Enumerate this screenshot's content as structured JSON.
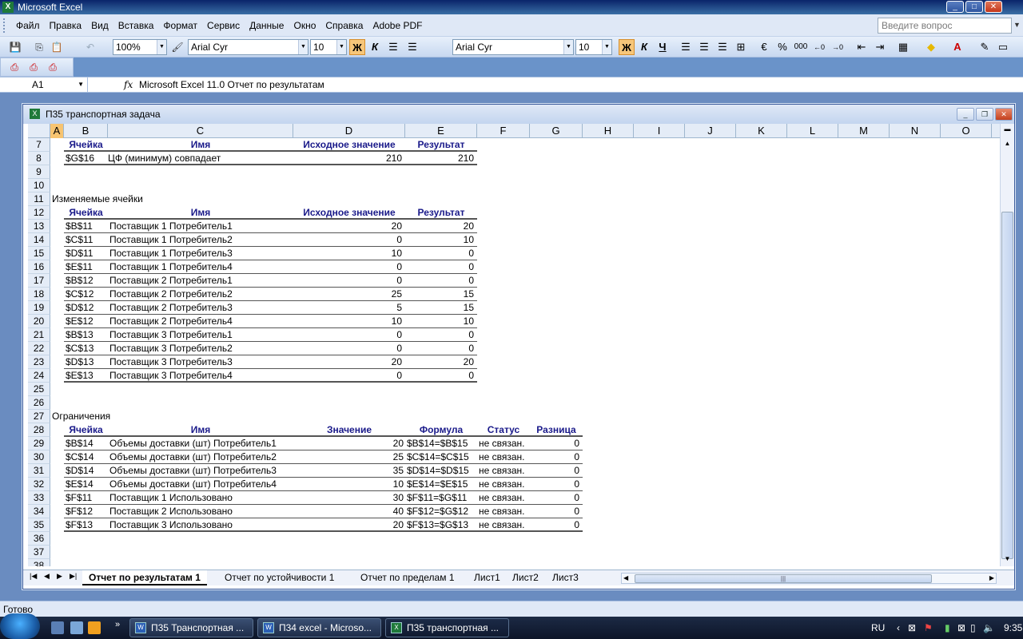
{
  "app": {
    "title": "Microsoft Excel",
    "ask_placeholder": "Введите вопрос"
  },
  "menu": [
    "Файл",
    "Правка",
    "Вид",
    "Вставка",
    "Формат",
    "Сервис",
    "Данные",
    "Окно",
    "Справка",
    "Adobe PDF"
  ],
  "toolbar": {
    "zoom": "100%",
    "font1": "Arial Cyr",
    "size1": "10",
    "font2": "Arial Cyr",
    "size2": "10",
    "bold": "Ж",
    "italic": "К",
    "underline": "Ч",
    "percent": "%",
    "thousands": "000"
  },
  "formula_bar": {
    "cell": "A1",
    "fx": "fx",
    "content": "Microsoft Excel 11.0 Отчет по результатам"
  },
  "workbook": {
    "title": "П35 транспортная задача"
  },
  "columns": [
    "A",
    "B",
    "C",
    "D",
    "E",
    "F",
    "G",
    "H",
    "I",
    "J",
    "K",
    "L",
    "M",
    "N",
    "O"
  ],
  "rows": [
    "7",
    "8",
    "9",
    "10",
    "11",
    "12",
    "13",
    "14",
    "15",
    "16",
    "17",
    "18",
    "19",
    "20",
    "21",
    "22",
    "23",
    "24",
    "25",
    "26",
    "27",
    "28",
    "29",
    "30",
    "31",
    "32",
    "33",
    "34",
    "35",
    "36",
    "37",
    "38"
  ],
  "target": {
    "headers": [
      "Ячейка",
      "Имя",
      "Исходное значение",
      "Результат"
    ],
    "row": {
      "cell": "$G$16",
      "name": "ЦФ (минимум) совпадает",
      "initial": "210",
      "result": "210"
    }
  },
  "variables": {
    "title": "Изменяемые ячейки",
    "headers": [
      "Ячейка",
      "Имя",
      "Исходное значение",
      "Результат"
    ],
    "rows": [
      {
        "cell": "$B$11",
        "name": "Поставщик 1 Потребитель1",
        "initial": "20",
        "result": "20"
      },
      {
        "cell": "$C$11",
        "name": "Поставщик 1 Потребитель2",
        "initial": "0",
        "result": "10"
      },
      {
        "cell": "$D$11",
        "name": "Поставщик 1 Потребитель3",
        "initial": "10",
        "result": "0"
      },
      {
        "cell": "$E$11",
        "name": "Поставщик 1 Потребитель4",
        "initial": "0",
        "result": "0"
      },
      {
        "cell": "$B$12",
        "name": "Поставщик 2 Потребитель1",
        "initial": "0",
        "result": "0"
      },
      {
        "cell": "$C$12",
        "name": "Поставщик 2 Потребитель2",
        "initial": "25",
        "result": "15"
      },
      {
        "cell": "$D$12",
        "name": "Поставщик 2 Потребитель3",
        "initial": "5",
        "result": "15"
      },
      {
        "cell": "$E$12",
        "name": "Поставщик 2 Потребитель4",
        "initial": "10",
        "result": "10"
      },
      {
        "cell": "$B$13",
        "name": "Поставщик 3 Потребитель1",
        "initial": "0",
        "result": "0"
      },
      {
        "cell": "$C$13",
        "name": "Поставщик 3 Потребитель2",
        "initial": "0",
        "result": "0"
      },
      {
        "cell": "$D$13",
        "name": "Поставщик 3 Потребитель3",
        "initial": "20",
        "result": "20"
      },
      {
        "cell": "$E$13",
        "name": "Поставщик 3 Потребитель4",
        "initial": "0",
        "result": "0"
      }
    ]
  },
  "constraints": {
    "title": "Ограничения",
    "headers": [
      "Ячейка",
      "Имя",
      "Значение",
      "Формула",
      "Статус",
      "Разница"
    ],
    "rows": [
      {
        "cell": "$B$14",
        "name": "Объемы доставки (шт) Потребитель1",
        "value": "20",
        "formula": "$B$14=$B$15",
        "status": "не связан.",
        "diff": "0"
      },
      {
        "cell": "$C$14",
        "name": "Объемы доставки (шт) Потребитель2",
        "value": "25",
        "formula": "$C$14=$C$15",
        "status": "не связан.",
        "diff": "0"
      },
      {
        "cell": "$D$14",
        "name": "Объемы доставки (шт) Потребитель3",
        "value": "35",
        "formula": "$D$14=$D$15",
        "status": "не связан.",
        "diff": "0"
      },
      {
        "cell": "$E$14",
        "name": "Объемы доставки (шт) Потребитель4",
        "value": "10",
        "formula": "$E$14=$E$15",
        "status": "не связан.",
        "diff": "0"
      },
      {
        "cell": "$F$11",
        "name": "Поставщик 1 Использовано",
        "value": "30",
        "formula": "$F$11=$G$11",
        "status": "не связан.",
        "diff": "0"
      },
      {
        "cell": "$F$12",
        "name": "Поставщик 2 Использовано",
        "value": "40",
        "formula": "$F$12=$G$12",
        "status": "не связан.",
        "diff": "0"
      },
      {
        "cell": "$F$13",
        "name": "Поставщик 3 Использовано",
        "value": "20",
        "formula": "$F$13=$G$13",
        "status": "не связан.",
        "diff": "0"
      }
    ]
  },
  "sheet_tabs": [
    "Отчет по результатам 1",
    "Отчет по устойчивости 1",
    "Отчет по пределам 1",
    "Лист1",
    "Лист2",
    "Лист3"
  ],
  "status": "Готово",
  "taskbar": {
    "tasks": [
      "П35 Транспортная ...",
      "П34 excel - Microso...",
      "П35 транспортная ..."
    ],
    "lang": "RU",
    "time": "9:35"
  }
}
